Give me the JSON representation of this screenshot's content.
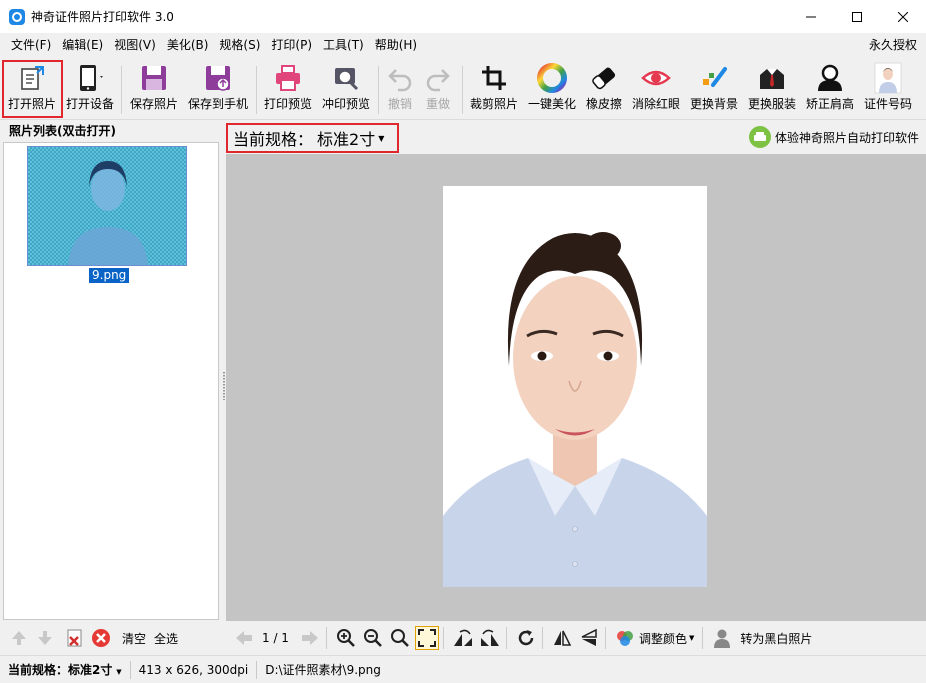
{
  "window": {
    "title": "神奇证件照片打印软件 3.0"
  },
  "menu": {
    "items": [
      "文件(F)",
      "编辑(E)",
      "视图(V)",
      "美化(B)",
      "规格(S)",
      "打印(P)",
      "工具(T)",
      "帮助(H)"
    ],
    "license": "永久授权"
  },
  "toolbar": {
    "open_photo": "打开照片",
    "open_device": "打开设备",
    "save_photo": "保存照片",
    "save_to_phone": "保存到手机",
    "print_preview": "打印预览",
    "develop_preview": "冲印预览",
    "undo": "撤销",
    "redo": "重做",
    "crop": "裁剪照片",
    "one_click_beautify": "一键美化",
    "eraser": "橡皮擦",
    "remove_red_eye": "消除红眼",
    "change_background": "更换背景",
    "change_clothes": "更换服装",
    "correct_shoulders": "矫正肩高",
    "id_size": "证件号码"
  },
  "left_panel": {
    "header": "照片列表(双击打开)",
    "files": [
      {
        "name": "9.png"
      }
    ],
    "clear": "清空",
    "select_all": "全选"
  },
  "spec_bar": {
    "label": "当前规格：",
    "value": "标准2寸",
    "promo": "体验神奇照片自动打印软件"
  },
  "bottom_bar": {
    "page": "1 / 1",
    "adjust_color": "调整颜色",
    "to_bw": "转为黑白照片"
  },
  "status": {
    "spec_label": "当前规格：",
    "spec_value": "标准2寸",
    "dimensions": "413 x 626, 300dpi",
    "path": "D:\\证件照素材\\9.png"
  },
  "colors": {
    "highlight": "#e0272e",
    "canvas_bg": "#c4c4c4",
    "selection": "#0a64c8"
  }
}
